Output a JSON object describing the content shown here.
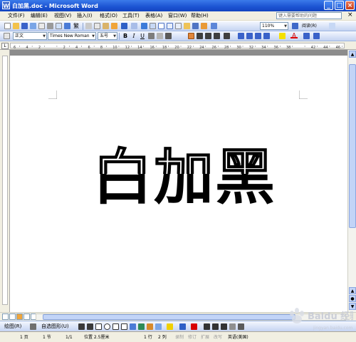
{
  "window": {
    "title": "白加黑.doc - Microsoft Word",
    "app_icon_letter": "W",
    "minimize": "_",
    "maximize": "□",
    "close": "×"
  },
  "menu": {
    "items": [
      "文件(F)",
      "编辑(E)",
      "视图(V)",
      "插入(I)",
      "格式(O)",
      "工具(T)",
      "表格(A)",
      "窗口(W)",
      "帮助(H)"
    ],
    "help_placeholder": "键入需要帮助的问题",
    "close_doc": "×"
  },
  "standard_toolbar": {
    "convert_label": "繁",
    "zoom": "110%",
    "read_label": "阅读(R)"
  },
  "format_toolbar": {
    "style": "正文",
    "font": "Times New Roman",
    "size": "五号",
    "bold": "B",
    "italic": "I",
    "underline": "U",
    "font_color_label": "A"
  },
  "ruler": {
    "tab_selector": "L",
    "labels": [
      "6",
      "4",
      "2",
      "",
      "2",
      "4",
      "6",
      "8",
      "10",
      "12",
      "14",
      "16",
      "18",
      "20",
      "22",
      "24",
      "26",
      "28",
      "30",
      "32",
      "34",
      "36",
      "38",
      "",
      "42",
      "44",
      "46"
    ]
  },
  "document": {
    "text": [
      "白",
      "加",
      "黑"
    ],
    "text_color": "#000000"
  },
  "drawing_toolbar": {
    "draw_label": "绘图(R)",
    "autoshapes_label": "自选图形(U)"
  },
  "status_bar": {
    "page": "1 页",
    "section": "1 节",
    "page_of": "1/1",
    "position": "位置 2.5厘米",
    "line": "1 行",
    "column": "2 列",
    "rec": "录制",
    "trk": "修订",
    "ext": "扩展",
    "ovr": "改写",
    "language": "英语(美国)"
  },
  "watermark": {
    "brand": "Baidu 经验",
    "url": "jingyan.baidu.com"
  },
  "colors": {
    "titlebar": "#1b53d2",
    "toolbar": "#c4d3f2",
    "chrome": "#f1efe2",
    "workspace_gray": "#8c8c8c"
  }
}
